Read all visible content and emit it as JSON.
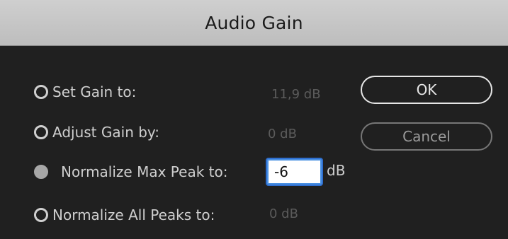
{
  "dialog": {
    "title": "Audio Gain"
  },
  "options": {
    "set_gain": {
      "label": "Set Gain to:",
      "value": "11,9 dB",
      "selected": false
    },
    "adjust_gain": {
      "label": "Adjust Gain by:",
      "value": "0 dB",
      "selected": false
    },
    "normalize_max_peak": {
      "label": "Normalize Max Peak to:",
      "input_value": "-6",
      "unit": "dB",
      "selected": true
    },
    "normalize_all_peaks": {
      "label": "Normalize All Peaks to:",
      "value": "0 dB",
      "selected": false
    }
  },
  "buttons": {
    "ok": "OK",
    "cancel": "Cancel"
  },
  "colors": {
    "title_bar": "#c8c8c8",
    "background": "#202020",
    "focus_ring": "#4a90e2"
  }
}
